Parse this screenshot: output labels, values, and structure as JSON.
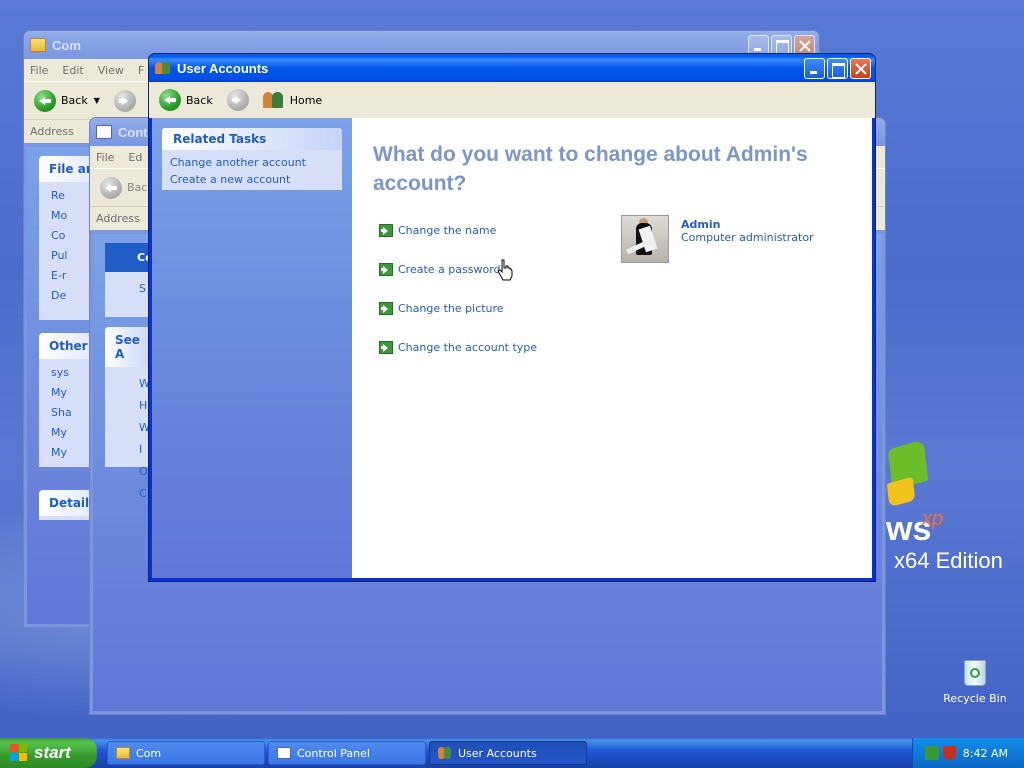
{
  "desktop": {
    "logo_text": "ws",
    "logo_xp": "xp",
    "logo_edition": "x64 Edition",
    "recycle_bin_label": "Recycle Bin"
  },
  "back_window_1": {
    "title": "Com",
    "menu": [
      "File",
      "Edit",
      "View",
      "F"
    ],
    "back_label": "Back",
    "address_label": "Address",
    "sidebar_sections": [
      "File an",
      "Other I",
      "Details"
    ],
    "file_tasks": [
      "Re",
      "Mo",
      "Co",
      "Pul",
      "E-r",
      "De"
    ],
    "other_places": [
      "sys",
      "My",
      "Sha",
      "My",
      "My"
    ]
  },
  "back_window_2": {
    "title": "Contr",
    "menu": [
      "File",
      "Ed"
    ],
    "back_label": "Bac",
    "address_label": "Address",
    "selected_item": "Co",
    "item_s": "S",
    "see_also": "See A",
    "see_also_items": [
      "W",
      "H",
      "W I",
      "O C"
    ]
  },
  "user_accounts": {
    "title": "User Accounts",
    "back_label": "Back",
    "home_label": "Home",
    "related_tasks": {
      "header": "Related Tasks",
      "items": [
        "Change another account",
        "Create a new account"
      ]
    },
    "question": "What do you want to change about Admin's account?",
    "actions": [
      "Change the name",
      "Create a password",
      "Change the picture",
      "Change the account type"
    ],
    "account": {
      "name": "Admin",
      "type": "Computer administrator"
    }
  },
  "taskbar": {
    "start_label": "start",
    "items": [
      "Com",
      "Control Panel",
      "User Accounts"
    ],
    "clock": "8:42 AM"
  },
  "colors": {
    "link_blue": "#215dc6",
    "title_gray_blue": "#7b96c9",
    "xp_title_blue": "#0a5ff0",
    "start_green": "#379b2e"
  }
}
